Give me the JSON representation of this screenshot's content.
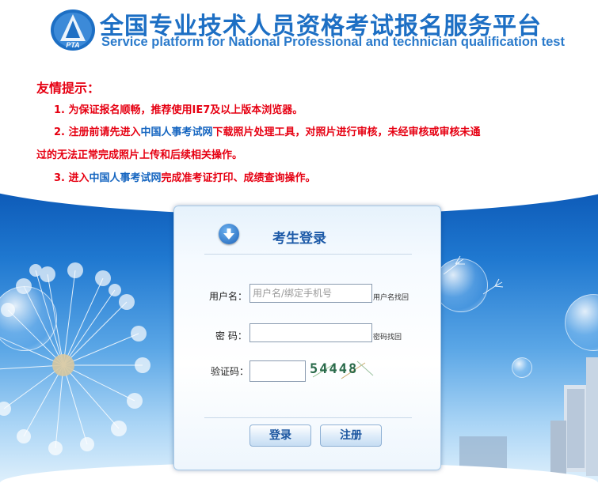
{
  "header": {
    "title_cn": "全国专业技术人员资格考试报名服务平台",
    "title_en": "Service platform for National Professional and technician qualification test",
    "logo_text": "PTA"
  },
  "tips": {
    "title": "友情提示：",
    "tip1": "1. 为保证报名顺畅，推荐使用IE7及以上版本浏览器。",
    "tip2_prefix": "2. 注册前请先进入",
    "tip2_link": "中国人事考试网",
    "tip2_suffix": "下载照片处理工具，对照片进行审核，未经审核或审核未通",
    "tip2_line2": "过的无法正常完成照片上传和后续相关操作。",
    "tip3_prefix": "3. 进入",
    "tip3_link": "中国人事考试网",
    "tip3_suffix": "完成准考证打印、成绩查询操作。"
  },
  "login": {
    "title": "考生登录",
    "username_label": "用户名：",
    "username_placeholder": "用户名/绑定手机号",
    "username_value": "",
    "username_recover": "用户名找回",
    "password_label": "密 码：",
    "password_value": "",
    "password_recover": "密码找回",
    "captcha_label": "验证码：",
    "captcha_value": "",
    "captcha_image_text": "54448",
    "login_button": "登录",
    "register_button": "注册"
  },
  "colors": {
    "brand_blue": "#1d6fc4",
    "warning_red": "#e60012",
    "link_blue": "#1565c0"
  }
}
